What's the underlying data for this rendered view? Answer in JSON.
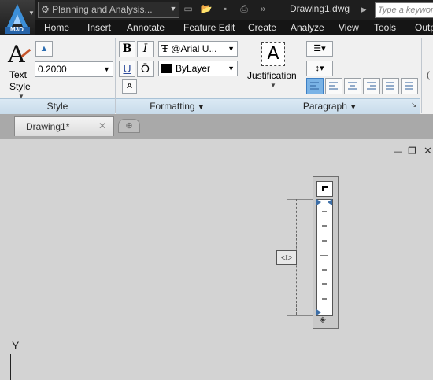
{
  "app": {
    "logo_text": "M3D",
    "workspace": "Planning and Analysis...",
    "document_title": "Drawing1.dwg",
    "search_placeholder": "Type a keyword"
  },
  "menu": [
    "Home",
    "Insert",
    "Annotate",
    "Feature Edit",
    "Create",
    "Analyze",
    "View",
    "Tools",
    "Outp"
  ],
  "ribbon": {
    "style_panel": {
      "title": "Style",
      "text_style_label_1": "Text",
      "text_style_label_2": "Style",
      "height_value": "0.2000"
    },
    "formatting_panel": {
      "title": "Formatting",
      "bold": "B",
      "italic": "I",
      "underline": "U",
      "overline": "Ō",
      "font": "@Arial U...",
      "color": "ByLayer"
    },
    "paragraph_panel": {
      "title": "Paragraph",
      "justification": "Justification"
    }
  },
  "tabs": {
    "drawing_tab": "Drawing1*"
  },
  "ucs": {
    "y_label": "Y"
  },
  "colors": {
    "ribbon_accent": "#3c7fc4",
    "drawing_bg": "#d3d3d3",
    "titlebar": "#1e1e1e"
  }
}
